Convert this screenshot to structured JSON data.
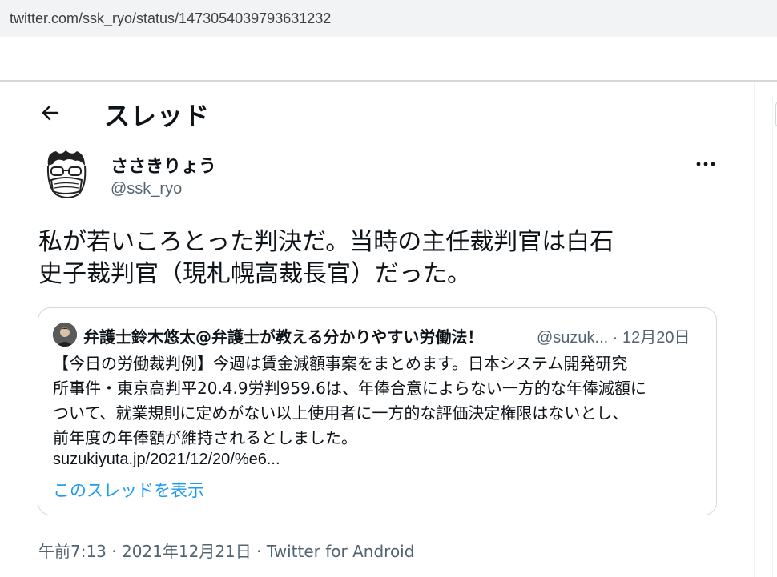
{
  "browser": {
    "url": "twitter.com/ssk_ryo/status/1473054039793631232"
  },
  "header": {
    "title": "スレッド",
    "back_icon": "arrow-left-icon"
  },
  "tweet": {
    "display_name": "ささきりょう",
    "handle": "@ssk_ryo",
    "more_icon": "more-horizontal-icon",
    "text": "私が若いころとった判決だ。当時の主任裁判官は白石\n史子裁判官（現札幌高裁長官）だった。",
    "quote": {
      "author_name": "弁護士鈴木悠太@弁護士が教える分かりやすい労働法！",
      "author_handle_time": "@suzuk... · 12月20日",
      "body": "【今日の労働裁判例】今週は賃金減額事案をまとめます。日本システム開発研究\n所事件・東京高判平20.4.9労判959.6は、年俸合意によらない一方的な年俸減額に\nついて、就業規則に定めがない以上使用者に一方的な評価決定権限はないとし、\n前年度の年俸額が維持されるとしました。",
      "link": "suzukiyuta.jp/2021/12/20/%e6...",
      "show_thread": "このスレッドを表示"
    },
    "timestamp": "午前7:13 · 2021年12月21日",
    "separator": " · ",
    "source": "Twitter for Android"
  },
  "colors": {
    "link": "#1d9bf0",
    "secondary_text": "#536471",
    "border": "#cfd9de",
    "url_bar": "#f1f3f4"
  }
}
